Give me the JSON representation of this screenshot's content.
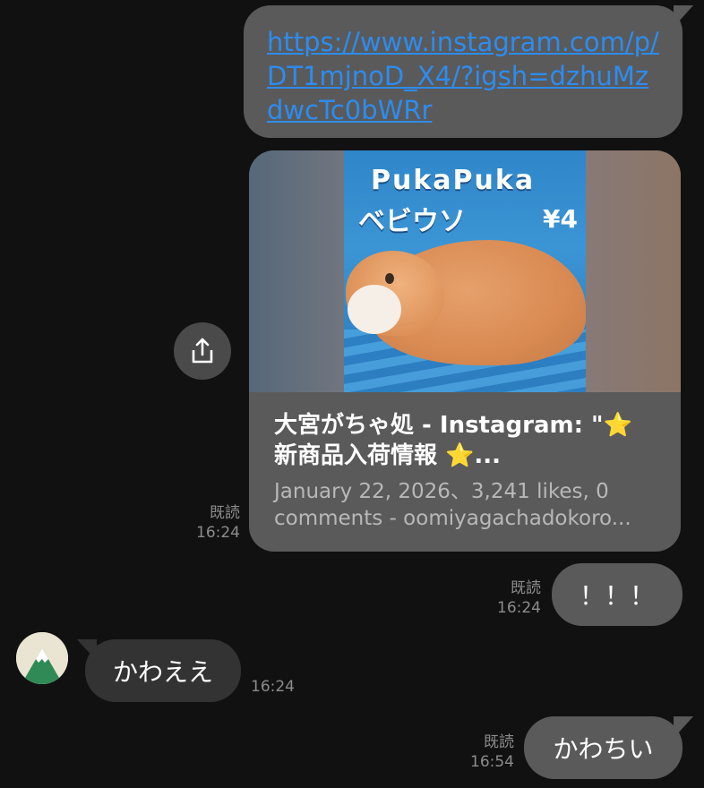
{
  "messages": {
    "link": {
      "url": "https://www.instagram.com/p/DT1mjnoD_X4/?igsh=dzhuMzdwcTc0bWRr"
    },
    "preview": {
      "poster_title": "PukaPuka",
      "poster_subtitle": "ベビウソ",
      "poster_price": "¥4",
      "title": "大宮がちゃ処 - Instagram: \"⭐ 新商品入荷情報 ⭐...",
      "description": "January 22, 2026、3,241 likes, 0 comments - oomiyagachadokoro...",
      "read_label": "既読",
      "time": "16:24"
    },
    "exclaim": {
      "text": "！！！",
      "read_label": "既読",
      "time": "16:24"
    },
    "incoming": {
      "text": "かわええ",
      "time": "16:24"
    },
    "last": {
      "text": "かわちい",
      "read_label": "既読",
      "time": "16:54"
    }
  },
  "icons": {
    "share": "share-icon",
    "avatar": "mountain-avatar-icon"
  },
  "colors": {
    "background": "#111111",
    "outgoing_bubble": "#5a5a5a",
    "incoming_bubble": "#333333",
    "link": "#2d8cf0",
    "meta_text": "#8c8c8c"
  }
}
